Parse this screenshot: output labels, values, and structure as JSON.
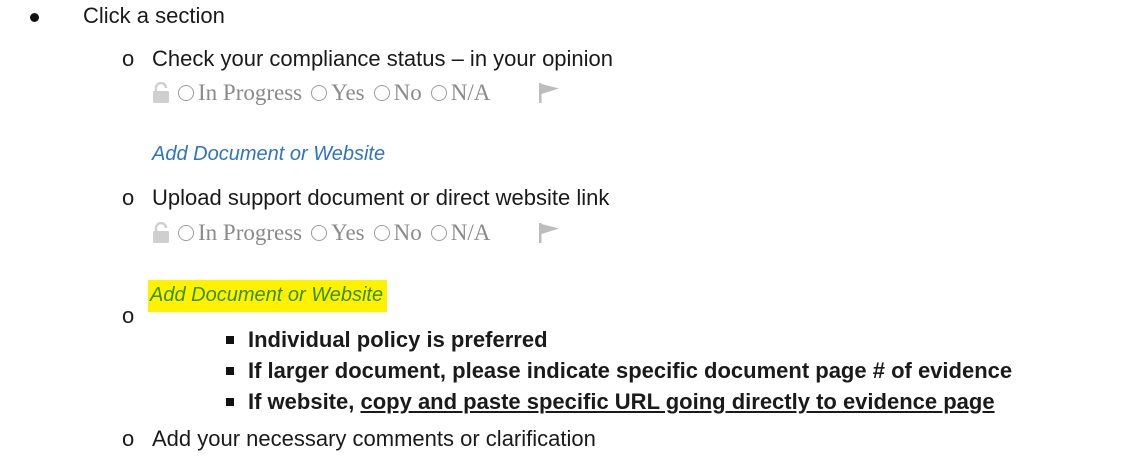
{
  "items": {
    "click_section": "Click a section",
    "check_status": "Check your compliance status – in your opinion",
    "upload_support": "Upload support document or direct website link",
    "add_comments": "Add your necessary comments or clarification"
  },
  "status_options": {
    "in_progress": "In Progress",
    "yes": "Yes",
    "no": "No",
    "na": "N/A"
  },
  "add_link_label": "Add Document or Website",
  "bullet_marker": "o",
  "notes": {
    "individual_policy": "Individual policy is preferred",
    "larger_document": "If larger document, please indicate specific document page # of evidence",
    "website_prefix": "If website, ",
    "website_underlined": "copy and paste specific URL going directly to evidence page"
  },
  "colors": {
    "link_blue": "#2f74c0",
    "highlight_yellow": "#fff200",
    "highlight_text_green": "#3a8e16",
    "muted_gray": "#8a8a8a"
  },
  "icons": [
    "lock-icon",
    "flag-icon"
  ]
}
